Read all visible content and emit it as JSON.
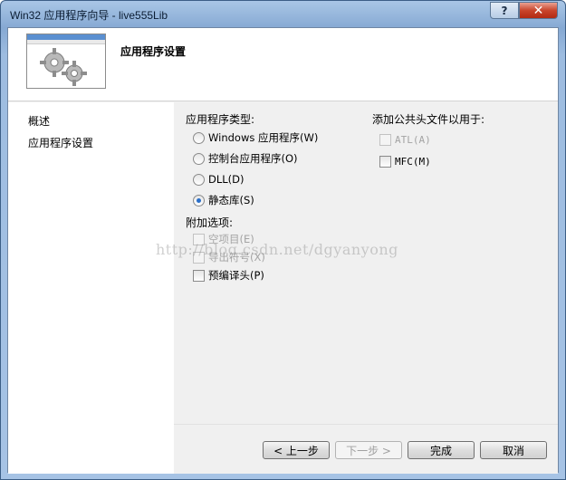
{
  "window": {
    "title": "Win32 应用程序向导 - live555Lib",
    "help_label": "?",
    "close_label": "✕"
  },
  "header": {
    "title": "应用程序设置",
    "image_icon": "gears-icon"
  },
  "nav": {
    "items": [
      {
        "label": "概述"
      },
      {
        "label": "应用程序设置"
      }
    ]
  },
  "app_type": {
    "label": "应用程序类型:",
    "options": [
      {
        "label": "Windows 应用程序(W)",
        "checked": false
      },
      {
        "label": "控制台应用程序(O)",
        "checked": false
      },
      {
        "label": "DLL(D)",
        "checked": false
      },
      {
        "label": "静态库(S)",
        "checked": true
      }
    ]
  },
  "additional": {
    "label": "附加选项:",
    "options": [
      {
        "label": "空项目(E)",
        "checked": false,
        "enabled": false
      },
      {
        "label": "导出符号(X)",
        "checked": false,
        "enabled": false
      },
      {
        "label": "预编译头(P)",
        "checked": false,
        "enabled": true
      }
    ]
  },
  "common_headers": {
    "label": "添加公共头文件以用于:",
    "options": [
      {
        "label": "ATL(A)",
        "checked": false,
        "enabled": false
      },
      {
        "label": "MFC(M)",
        "checked": false,
        "enabled": true
      }
    ]
  },
  "watermark": "http://blog.csdn.net/dgyanyong",
  "buttons": {
    "prev": "< 上一步",
    "next": "下一步 >",
    "finish": "完成",
    "cancel": "取消"
  }
}
